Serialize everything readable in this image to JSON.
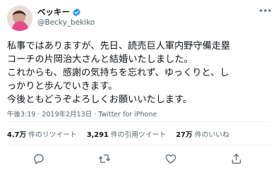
{
  "user": {
    "display_name": "ベッキー",
    "handle": "@Becky_bekiko"
  },
  "tweet": {
    "text": "私事ではありますが、先日、読売巨人軍内野守備走塁\nコーチの片岡治大さんと結婚いたしました。\nこれからも、感謝の気持ちを忘れず、ゆっくりと、し\nっかりと歩んでいきます。\n今後ともどうぞよろしくお願いいたします。",
    "time": "午後3:19",
    "date": "2019年2月13日",
    "source": "Twitter for iPhone",
    "meta_separator": "·"
  },
  "stats": {
    "retweets": {
      "count": "4.7万",
      "label": "件のリツイート"
    },
    "quotes": {
      "count": "3,291",
      "label": "件の引用ツイート"
    },
    "likes": {
      "count": "27万",
      "label": "件のいいね"
    }
  },
  "icons": {
    "verified": "verified-badge-icon",
    "more": "more-dots-icon",
    "reply": "reply-icon",
    "retweet": "retweet-icon",
    "like": "heart-icon",
    "share": "share-icon"
  },
  "colors": {
    "verified_blue": "#1d9bf0",
    "text_primary": "#0f1419",
    "text_secondary": "#536471",
    "divider": "#eff3f4"
  }
}
